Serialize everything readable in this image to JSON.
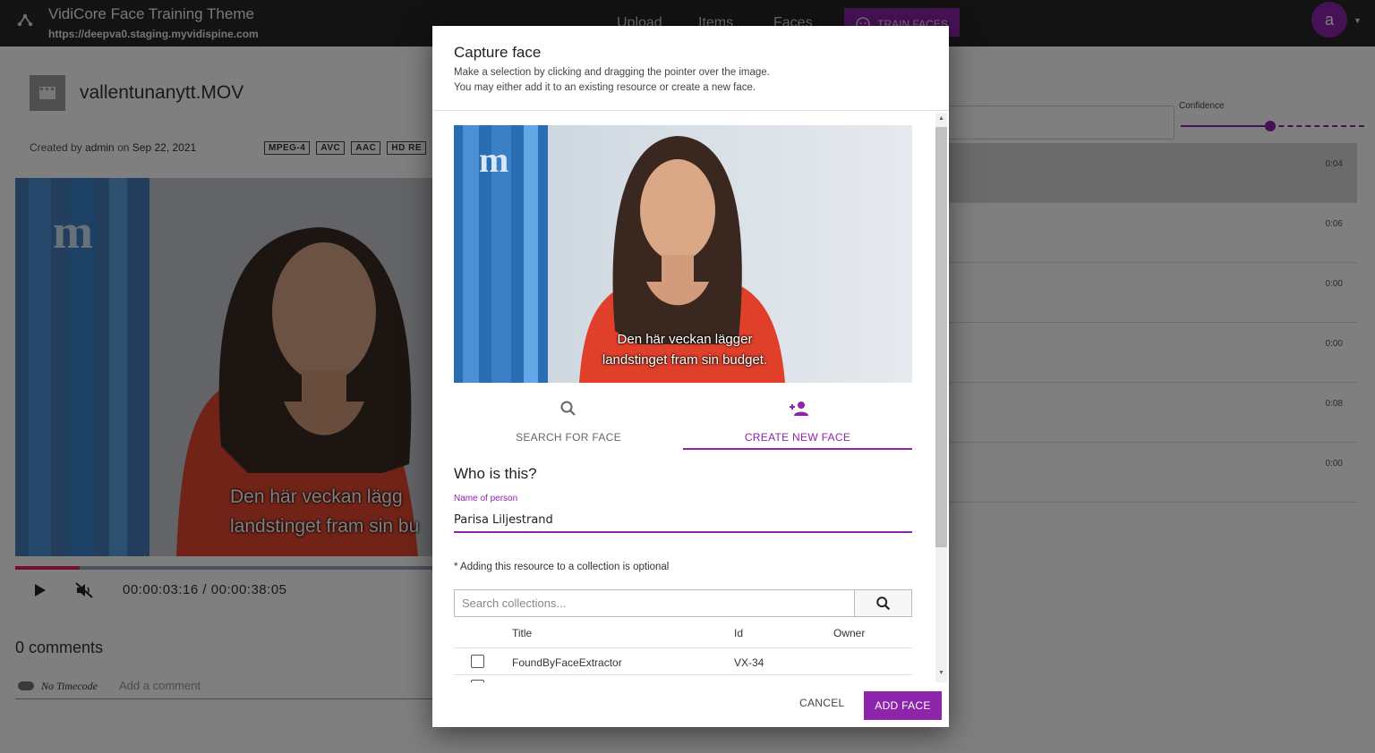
{
  "topbar": {
    "title": "VidiCore Face Training Theme",
    "url": "https://deepva0.staging.myvidispine.com",
    "nav": [
      "Upload",
      "Items",
      "Faces"
    ],
    "train_label": "TRAIN FACES",
    "user_initial": "a"
  },
  "item": {
    "filename": "vallentunanytt.MOV",
    "created_prefix": "Created by",
    "created_by": "admin",
    "created_on_word": "on",
    "created_date": "Sep 22, 2021",
    "badges": [
      "MPEG-4",
      "AVC",
      "AAC",
      "HD RE"
    ]
  },
  "player": {
    "timecode_current": "00:00:03:16",
    "timecode_sep": "/",
    "timecode_total": "00:00:38:05",
    "progress_fraction": 0.153,
    "subtitle_line1": "Den här veckan lägg",
    "subtitle_line2": "landstinget fram sin bu"
  },
  "comments": {
    "count_label": "0 comments",
    "timecode_toggle_label": "No Timecode",
    "placeholder": "Add a comment"
  },
  "results": {
    "confidence_label": "Confidence",
    "confidence_fraction": 0.49,
    "times": [
      "0:04",
      "0:06",
      "0:00",
      "0:00",
      "0:08",
      "0:00"
    ]
  },
  "dialog": {
    "title": "Capture face",
    "subtitle_line1": "Make a selection by clicking and dragging the pointer over the image.",
    "subtitle_line2": "You may either add it to an existing resource or create a new face.",
    "frame_subtitle_line1": "Den här veckan lägger",
    "frame_subtitle_line2": "landstinget fram sin budget.",
    "tabs": {
      "search": "SEARCH FOR FACE",
      "create": "CREATE NEW FACE"
    },
    "who_heading": "Who is this?",
    "name_label": "Name of person",
    "name_value": "Parisa Liljestrand",
    "optional_note": "* Adding this resource to a collection is optional",
    "collection_search_placeholder": "Search collections...",
    "table": {
      "headers": [
        "Title",
        "Id",
        "Owner"
      ],
      "rows": [
        {
          "title": "FoundByFaceExtractor",
          "id": "VX-34",
          "owner": ""
        }
      ]
    },
    "cancel_label": "CANCEL",
    "add_label": "ADD FACE"
  },
  "colors": {
    "accent": "#8e24aa",
    "topbar": "#262626",
    "progress": "#e91e63"
  }
}
